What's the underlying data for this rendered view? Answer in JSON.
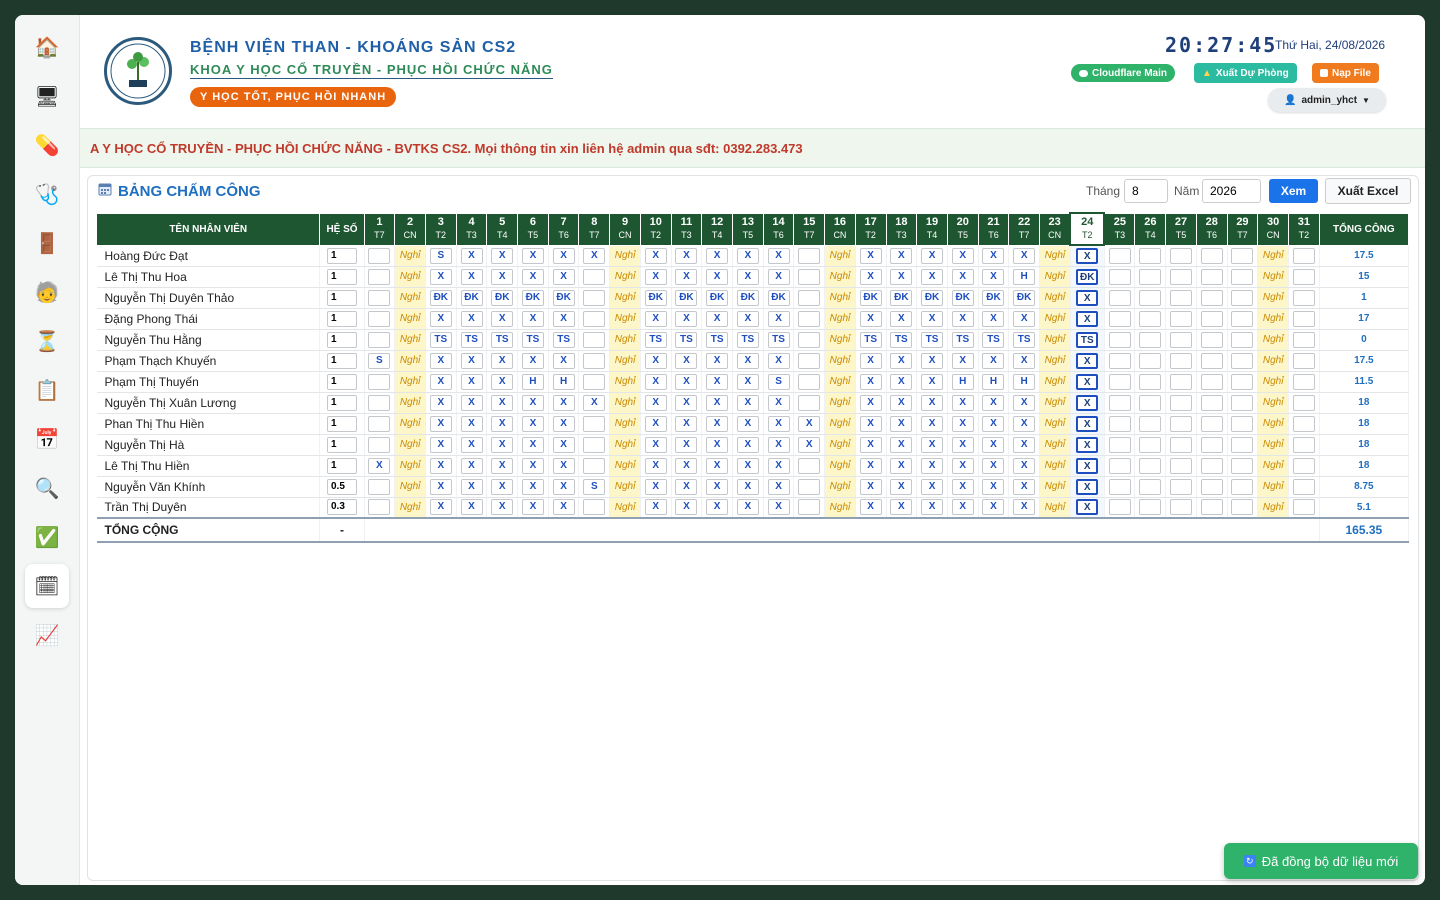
{
  "sidebar": {
    "items": [
      {
        "icon": "home-icon",
        "glyph": "🏠"
      },
      {
        "icon": "monitor-icon",
        "glyph": "🖥"
      },
      {
        "icon": "pill-icon",
        "glyph": "💊"
      },
      {
        "icon": "stethoscope-icon",
        "glyph": "🩺"
      },
      {
        "icon": "door-icon",
        "glyph": "🚪"
      },
      {
        "icon": "person-icon",
        "glyph": "🧓"
      },
      {
        "icon": "hourglass-icon",
        "glyph": "⏳"
      },
      {
        "icon": "clipboard-icon",
        "glyph": "📋"
      },
      {
        "icon": "calendar-icon",
        "glyph": "📅"
      },
      {
        "icon": "search-icon",
        "glyph": "🔍"
      },
      {
        "icon": "check-icon",
        "glyph": "✅"
      },
      {
        "icon": "calendar-grid-icon",
        "glyph": "🗓"
      },
      {
        "icon": "chart-icon",
        "glyph": "📈"
      }
    ],
    "active_index": 11
  },
  "header": {
    "title": "BỆNH VIỆN THAN - KHOÁNG SẢN CS2",
    "subtitle": "KHOA Y HỌC CỔ TRUYỀN - PHỤC HỒI CHỨC NĂNG",
    "slogan": "Y HỌC TỐT, PHỤC HỒI NHANH",
    "clock": "20:27:45",
    "date": "Thứ Hai, 24/08/2026",
    "btn_cloudflare": "Cloudflare Main",
    "btn_export": "Xuất Dự Phòng",
    "btn_load": "Nạp File",
    "user": "admin_yhct"
  },
  "marquee": "A Y HỌC CỔ TRUYỀN - PHỤC HỒI CHỨC NĂNG - BVTKS CS2. Mọi thông tin xin liên hệ admin qua sđt: 0392.283.473",
  "panel": {
    "title": "BẢNG CHẤM CÔNG",
    "label_month": "Tháng",
    "month": "8",
    "label_year": "Năm",
    "year": "2026",
    "btn_view": "Xem",
    "btn_excel": "Xuất Excel"
  },
  "table": {
    "col_name": "TÊN NHÂN VIÊN",
    "col_coef": "HỆ SỐ",
    "col_total": "TỔNG CÔNG",
    "today": 24,
    "days": [
      {
        "n": "1",
        "w": "T7"
      },
      {
        "n": "2",
        "w": "CN"
      },
      {
        "n": "3",
        "w": "T2"
      },
      {
        "n": "4",
        "w": "T3"
      },
      {
        "n": "5",
        "w": "T4"
      },
      {
        "n": "6",
        "w": "T5"
      },
      {
        "n": "7",
        "w": "T6"
      },
      {
        "n": "8",
        "w": "T7"
      },
      {
        "n": "9",
        "w": "CN"
      },
      {
        "n": "10",
        "w": "T2"
      },
      {
        "n": "11",
        "w": "T3"
      },
      {
        "n": "12",
        "w": "T4"
      },
      {
        "n": "13",
        "w": "T5"
      },
      {
        "n": "14",
        "w": "T6"
      },
      {
        "n": "15",
        "w": "T7"
      },
      {
        "n": "16",
        "w": "CN"
      },
      {
        "n": "17",
        "w": "T2"
      },
      {
        "n": "18",
        "w": "T3"
      },
      {
        "n": "19",
        "w": "T4"
      },
      {
        "n": "20",
        "w": "T5"
      },
      {
        "n": "21",
        "w": "T6"
      },
      {
        "n": "22",
        "w": "T7"
      },
      {
        "n": "23",
        "w": "CN"
      },
      {
        "n": "24",
        "w": "T2"
      },
      {
        "n": "25",
        "w": "T3"
      },
      {
        "n": "26",
        "w": "T4"
      },
      {
        "n": "27",
        "w": "T5"
      },
      {
        "n": "28",
        "w": "T6"
      },
      {
        "n": "29",
        "w": "T7"
      },
      {
        "n": "30",
        "w": "CN"
      },
      {
        "n": "31",
        "w": "T2"
      }
    ],
    "off_label": "Nghỉ",
    "rows": [
      {
        "name": "Hoàng Đức Đạt",
        "coef": "1",
        "total": "17.5",
        "cells": [
          "",
          "N",
          "S",
          "X",
          "X",
          "X",
          "X",
          "X",
          "N",
          "X",
          "X",
          "X",
          "X",
          "X",
          "",
          "N",
          "X",
          "X",
          "X",
          "X",
          "X",
          "X",
          "N",
          "X",
          "",
          "",
          "",
          "",
          "",
          "N",
          ""
        ]
      },
      {
        "name": "Lê Thị Thu Hoa",
        "coef": "1",
        "total": "15",
        "cells": [
          "",
          "N",
          "X",
          "X",
          "X",
          "X",
          "X",
          "",
          "N",
          "X",
          "X",
          "X",
          "X",
          "X",
          "",
          "N",
          "X",
          "X",
          "X",
          "X",
          "X",
          "H",
          "N",
          "ĐK",
          "",
          "",
          "",
          "",
          "",
          "N",
          ""
        ]
      },
      {
        "name": "Nguyễn Thị Duyên Thảo",
        "coef": "1",
        "total": "1",
        "cells": [
          "",
          "N",
          "ĐK",
          "ĐK",
          "ĐK",
          "ĐK",
          "ĐK",
          "",
          "N",
          "ĐK",
          "ĐK",
          "ĐK",
          "ĐK",
          "ĐK",
          "",
          "N",
          "ĐK",
          "ĐK",
          "ĐK",
          "ĐK",
          "ĐK",
          "ĐK",
          "N",
          "X",
          "",
          "",
          "",
          "",
          "",
          "N",
          ""
        ]
      },
      {
        "name": "Đặng Phong Thái",
        "coef": "1",
        "total": "17",
        "cells": [
          "",
          "N",
          "X",
          "X",
          "X",
          "X",
          "X",
          "",
          "N",
          "X",
          "X",
          "X",
          "X",
          "X",
          "",
          "N",
          "X",
          "X",
          "X",
          "X",
          "X",
          "X",
          "N",
          "X",
          "",
          "",
          "",
          "",
          "",
          "N",
          ""
        ]
      },
      {
        "name": "Nguyễn Thu Hằng",
        "coef": "1",
        "total": "0",
        "cells": [
          "",
          "N",
          "TS",
          "TS",
          "TS",
          "TS",
          "TS",
          "",
          "N",
          "TS",
          "TS",
          "TS",
          "TS",
          "TS",
          "",
          "N",
          "TS",
          "TS",
          "TS",
          "TS",
          "TS",
          "TS",
          "N",
          "TS",
          "",
          "",
          "",
          "",
          "",
          "N",
          ""
        ]
      },
      {
        "name": "Phạm Thạch Khuyến",
        "coef": "1",
        "total": "17.5",
        "cells": [
          "S",
          "N",
          "X",
          "X",
          "X",
          "X",
          "X",
          "",
          "N",
          "X",
          "X",
          "X",
          "X",
          "X",
          "",
          "N",
          "X",
          "X",
          "X",
          "X",
          "X",
          "X",
          "N",
          "X",
          "",
          "",
          "",
          "",
          "",
          "N",
          ""
        ]
      },
      {
        "name": "Phạm Thị Thuyến",
        "coef": "1",
        "total": "11.5",
        "cells": [
          "",
          "N",
          "X",
          "X",
          "X",
          "H",
          "H",
          "",
          "N",
          "X",
          "X",
          "X",
          "X",
          "S",
          "",
          "N",
          "X",
          "X",
          "X",
          "H",
          "H",
          "H",
          "N",
          "X",
          "",
          "",
          "",
          "",
          "",
          "N",
          ""
        ]
      },
      {
        "name": "Nguyễn Thị Xuân Lương",
        "coef": "1",
        "total": "18",
        "cells": [
          "",
          "N",
          "X",
          "X",
          "X",
          "X",
          "X",
          "X",
          "N",
          "X",
          "X",
          "X",
          "X",
          "X",
          "",
          "N",
          "X",
          "X",
          "X",
          "X",
          "X",
          "X",
          "N",
          "X",
          "",
          "",
          "",
          "",
          "",
          "N",
          ""
        ]
      },
      {
        "name": "Phan Thị Thu Hiền",
        "coef": "1",
        "total": "18",
        "cells": [
          "",
          "N",
          "X",
          "X",
          "X",
          "X",
          "X",
          "",
          "N",
          "X",
          "X",
          "X",
          "X",
          "X",
          "X",
          "N",
          "X",
          "X",
          "X",
          "X",
          "X",
          "X",
          "N",
          "X",
          "",
          "",
          "",
          "",
          "",
          "N",
          ""
        ]
      },
      {
        "name": "Nguyễn Thị Hà",
        "coef": "1",
        "total": "18",
        "cells": [
          "",
          "N",
          "X",
          "X",
          "X",
          "X",
          "X",
          "",
          "N",
          "X",
          "X",
          "X",
          "X",
          "X",
          "X",
          "N",
          "X",
          "X",
          "X",
          "X",
          "X",
          "X",
          "N",
          "X",
          "",
          "",
          "",
          "",
          "",
          "N",
          ""
        ]
      },
      {
        "name": "Lê Thị Thu Hiền",
        "coef": "1",
        "total": "18",
        "cells": [
          "X",
          "N",
          "X",
          "X",
          "X",
          "X",
          "X",
          "",
          "N",
          "X",
          "X",
          "X",
          "X",
          "X",
          "",
          "N",
          "X",
          "X",
          "X",
          "X",
          "X",
          "X",
          "N",
          "X",
          "",
          "",
          "",
          "",
          "",
          "N",
          ""
        ]
      },
      {
        "name": "Nguyễn Văn Khính",
        "coef": "0.5",
        "total": "8.75",
        "cells": [
          "",
          "N",
          "X",
          "X",
          "X",
          "X",
          "X",
          "S",
          "N",
          "X",
          "X",
          "X",
          "X",
          "X",
          "",
          "N",
          "X",
          "X",
          "X",
          "X",
          "X",
          "X",
          "N",
          "X",
          "",
          "",
          "",
          "",
          "",
          "N",
          ""
        ]
      },
      {
        "name": "Trần Thị Duyên",
        "coef": "0.3",
        "total": "5.1",
        "cells": [
          "",
          "N",
          "X",
          "X",
          "X",
          "X",
          "X",
          "",
          "N",
          "X",
          "X",
          "X",
          "X",
          "X",
          "",
          "N",
          "X",
          "X",
          "X",
          "X",
          "X",
          "X",
          "N",
          "X",
          "",
          "",
          "",
          "",
          "",
          "N",
          ""
        ]
      }
    ],
    "sum_label": "TỔNG CỘNG",
    "sum_coef": "-",
    "sum_total": "165.35"
  },
  "toast": "Đã đồng bộ dữ liệu mới"
}
